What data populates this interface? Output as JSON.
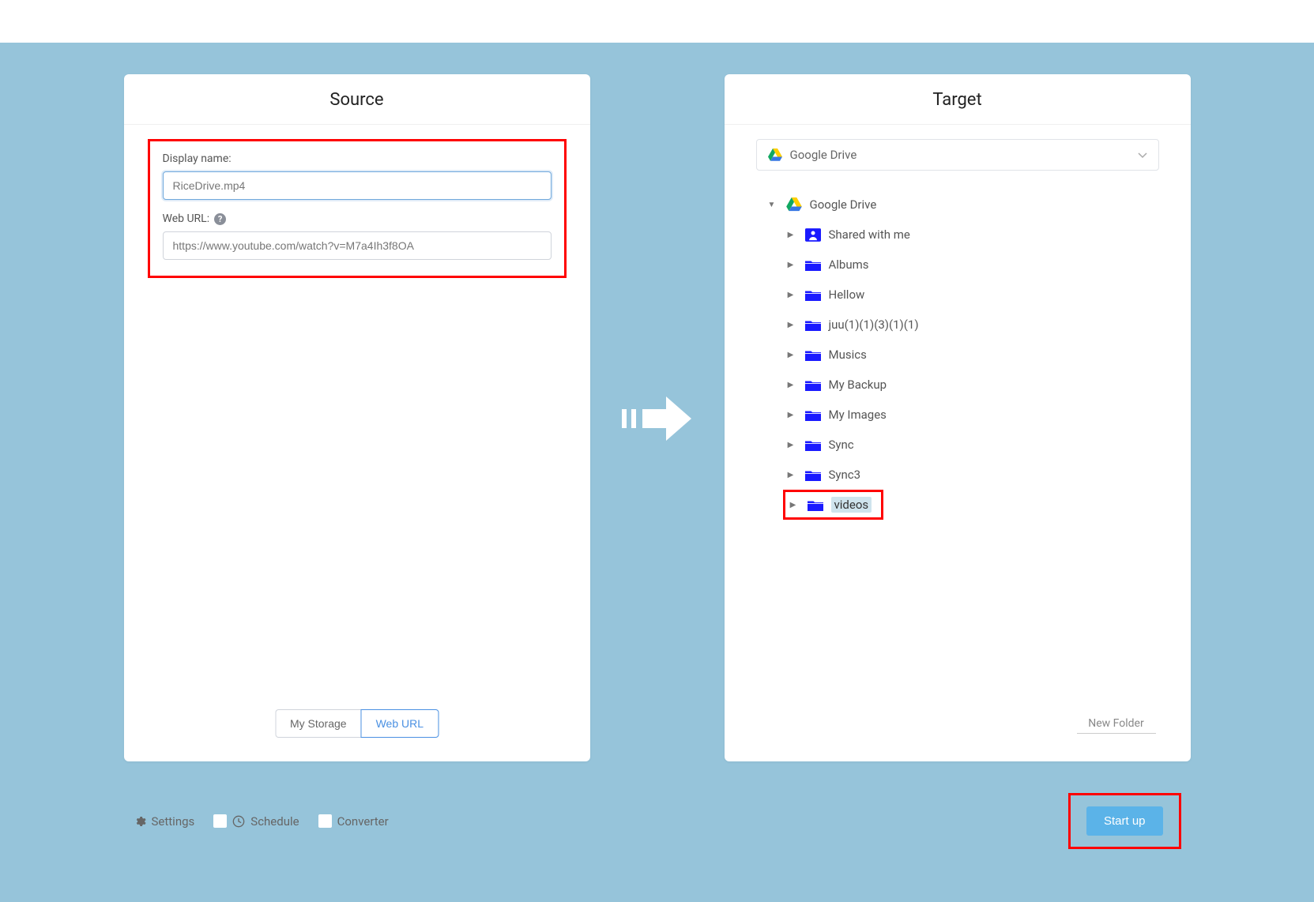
{
  "source": {
    "title": "Source",
    "display_name_label": "Display name:",
    "display_name_value": "RiceDrive.mp4",
    "web_url_label": "Web URL:",
    "web_url_value": "https://www.youtube.com/watch?v=M7a4Ih3f8OA",
    "tabs": {
      "my_storage": "My Storage",
      "web_url": "Web URL"
    }
  },
  "target": {
    "title": "Target",
    "selected_drive": "Google Drive",
    "root_label": "Google Drive",
    "folders": [
      {
        "name": "Shared with me",
        "icon": "shared"
      },
      {
        "name": "Albums",
        "icon": "folder"
      },
      {
        "name": "Hellow",
        "icon": "folder"
      },
      {
        "name": "juu(1)(1)(3)(1)(1)",
        "icon": "folder"
      },
      {
        "name": "Musics",
        "icon": "folder"
      },
      {
        "name": "My Backup",
        "icon": "folder"
      },
      {
        "name": "My Images",
        "icon": "folder"
      },
      {
        "name": "Sync",
        "icon": "folder"
      },
      {
        "name": "Sync3",
        "icon": "folder"
      },
      {
        "name": "videos",
        "icon": "folder",
        "selected": true,
        "highlight": true
      }
    ],
    "new_folder": "New Folder"
  },
  "footer": {
    "settings": "Settings",
    "schedule": "Schedule",
    "converter": "Converter",
    "start": "Start up"
  }
}
